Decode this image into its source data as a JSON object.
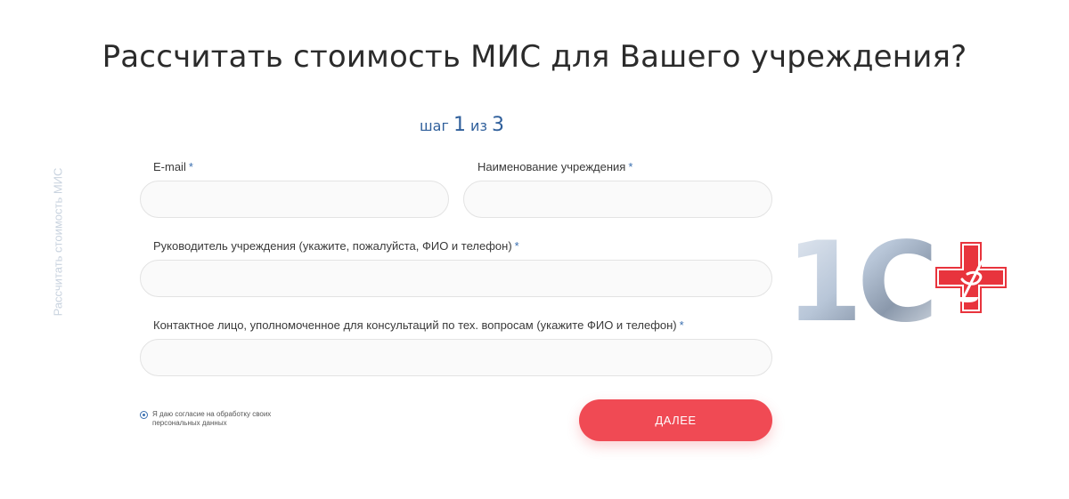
{
  "page": {
    "title": "Рассчитать стоимость МИС для Вашего учреждения?",
    "side_label": "Рассчитать стоимость МИС"
  },
  "step": {
    "prefix": "шаг",
    "current": "1",
    "separator": "из",
    "total": "3"
  },
  "form": {
    "required_mark": "*",
    "email": {
      "label": "E-mail",
      "value": "",
      "placeholder": ""
    },
    "institution": {
      "label": "Наименование учреждения",
      "value": "",
      "placeholder": ""
    },
    "head": {
      "label": "Руководитель учреждения (укажите, пожалуйста, ФИО и телефон)",
      "value": "",
      "placeholder": ""
    },
    "contact": {
      "label": "Контактное лицо, уполномоченное для консультаций по тех. вопросам (укажите ФИО и телефон)",
      "value": "",
      "placeholder": ""
    },
    "consent_text": "Я даю согласие на обработку своих персональных данных",
    "consent_checked": true,
    "next_button": "ДАЛЕЕ"
  },
  "logo": {
    "text": "1С",
    "icon": "medical-cross-icon"
  },
  "colors": {
    "accent_blue": "#2f5f9b",
    "button_red": "#f04a54",
    "logo_red": "#e8343d"
  }
}
